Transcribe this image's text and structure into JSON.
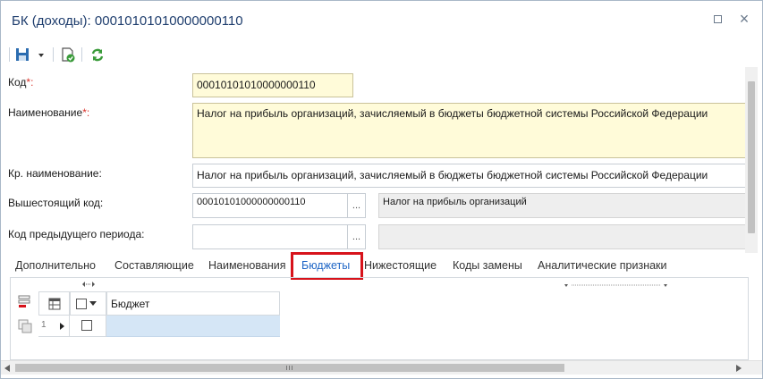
{
  "window": {
    "title": "БК (доходы): 00010101010000000110",
    "maximize_icon": "maximize-icon",
    "close_glyph": "×"
  },
  "toolbar": {
    "icons": [
      "save-icon",
      "dropdown-arrow-icon",
      "check-document-icon",
      "refresh-icon"
    ]
  },
  "form": {
    "code": {
      "label": "Код",
      "required_mark": "*:",
      "value": "00010101010000000110"
    },
    "name": {
      "label": "Наименование",
      "required_mark": "*:",
      "value": "Налог на прибыль организаций, зачисляемый в бюджеты бюджетной системы Российской Федерации"
    },
    "short_name": {
      "label": "Кр. наименование:",
      "value": "Налог на прибыль организаций, зачисляемый в бюджеты бюджетной системы Российской Федерации"
    },
    "parent_code": {
      "label": "Вышестоящий код:",
      "value": "00010101000000000110",
      "button": "...",
      "description": "Налог на прибыль организаций"
    },
    "prev_code": {
      "label": "Код предыдущего периода:",
      "value": "",
      "button": "...",
      "description": ""
    }
  },
  "tabs": [
    {
      "label": "Дополнительно",
      "active": false
    },
    {
      "label": "Составляющие",
      "active": false
    },
    {
      "label": "Наименования",
      "active": false
    },
    {
      "label": "Бюджеты",
      "active": true
    },
    {
      "label": "Нижестоящие",
      "active": false
    },
    {
      "label": "Коды замены",
      "active": false
    },
    {
      "label": "Аналитические признаки",
      "active": false
    }
  ],
  "grid": {
    "column_header": "Бюджет",
    "rows": [
      {
        "num": "1",
        "value": ""
      }
    ]
  },
  "colors": {
    "title": "#1f3e6e",
    "accent_tab": "#1f66c6",
    "highlight": "#d7131b",
    "required_field_bg": "#fffbd9",
    "selected_row_bg": "#d5e6f6"
  }
}
